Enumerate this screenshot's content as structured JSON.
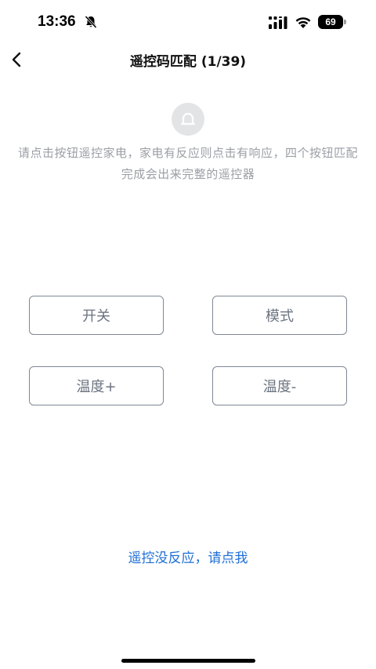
{
  "status_bar": {
    "time": "13:36",
    "battery_level": "69",
    "icons": [
      "bell-slash-icon",
      "signal-icon",
      "wifi-icon",
      "battery-icon"
    ]
  },
  "nav": {
    "title": "遥控码匹配 (1/39)",
    "back_icon": "chevron-left-icon"
  },
  "main": {
    "remote_icon": "remote-control-icon",
    "instruction": "请点击按钮遥控家电，家电有反应则点击有响应，四个按钮匹配完成会出来完整的遥控器",
    "buttons": {
      "power": "开关",
      "mode": "模式",
      "temp_up": "温度+",
      "temp_down": "温度-"
    },
    "no_response_link": "遥控没反应，请点我"
  },
  "colors": {
    "button_border": "#7e8795",
    "button_text": "#6c7480",
    "instruction_text": "#9b9fa6",
    "link": "#1f6fd6",
    "icon_bg": "#e3e4e6"
  }
}
